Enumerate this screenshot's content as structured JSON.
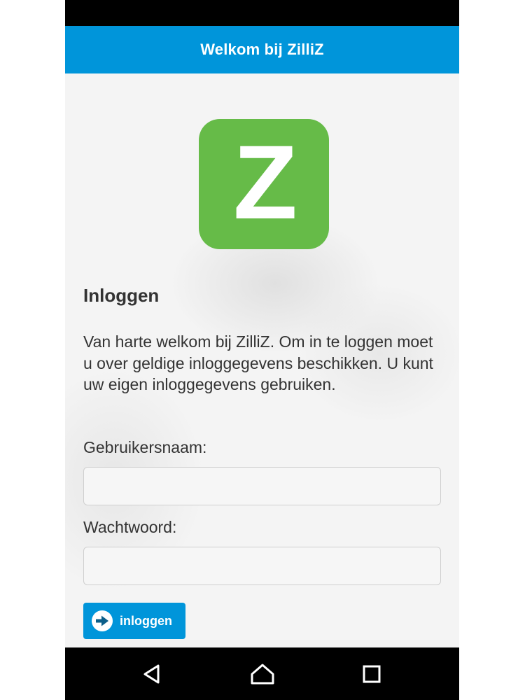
{
  "header": {
    "title": "Welkom bij ZilliZ"
  },
  "logo": {
    "letter": "Z",
    "color": "#66bb48"
  },
  "login": {
    "heading": "Inloggen",
    "intro": "Van harte welkom bij ZilliZ. Om in te loggen moet u over geldige inloggegevens beschikken. U kunt uw eigen inloggegevens gebruiken.",
    "username_label": "Gebruikersnaam:",
    "username_value": "",
    "password_label": "Wachtwoord:",
    "password_value": "",
    "button_label": "inloggen"
  },
  "navigation": {
    "back_icon": "back-triangle-icon",
    "home_icon": "home-icon",
    "recents_icon": "recents-square-icon"
  },
  "colors": {
    "accent": "#0095da",
    "logo_green": "#66bb48",
    "text": "#333333"
  }
}
